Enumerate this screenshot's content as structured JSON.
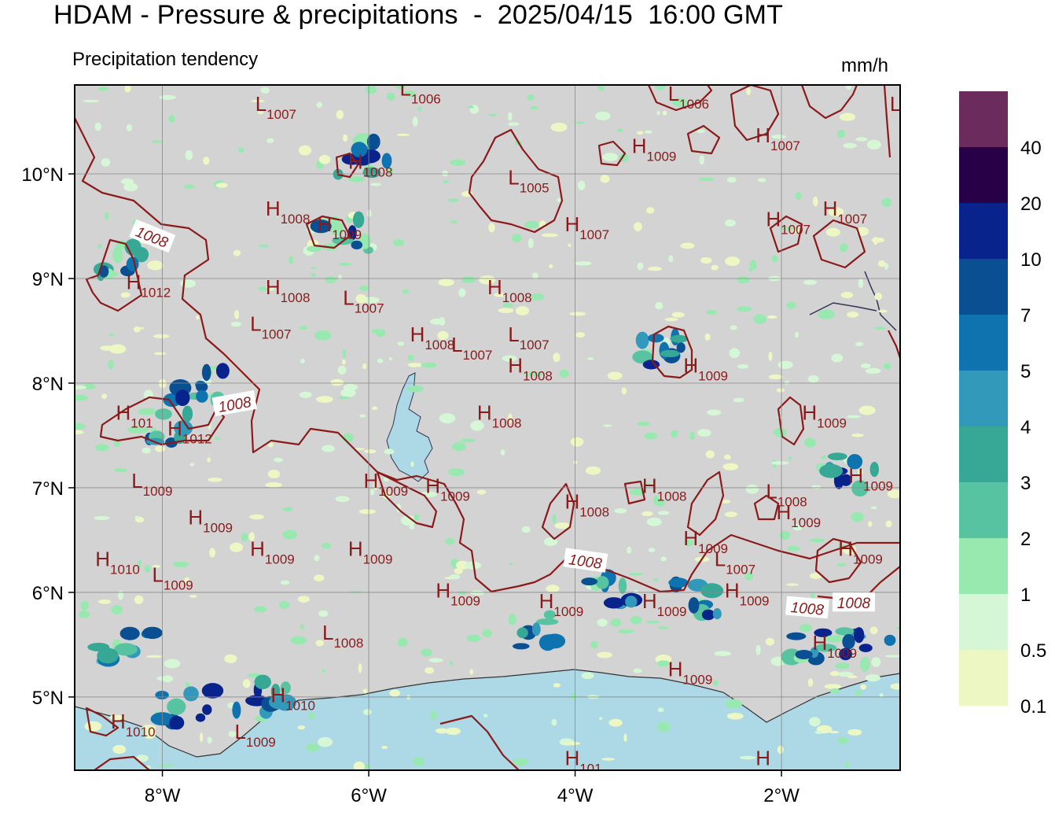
{
  "header": {
    "title": "HDAM - Pressure & precipitations  -  2025/04/15  16:00 GMT",
    "subtitle": "Precipitation tendency",
    "units": "mm/h"
  },
  "map": {
    "lon_range": [
      -8.85,
      -0.85
    ],
    "lat_range": [
      4.3,
      10.85
    ],
    "lat_ticks": [
      "5°N",
      "6°N",
      "7°N",
      "8°N",
      "9°N",
      "10°N"
    ],
    "lon_ticks": [
      "8°W",
      "6°W",
      "4°W",
      "2°W"
    ],
    "colors": {
      "land": "#d3d3d3",
      "sea": "#add8e6",
      "isobar": "#8b1a1a",
      "label": "#8b1a1a",
      "grid": "#888888"
    }
  },
  "pressure_labels": [
    {
      "k": "L",
      "v": "1007",
      "lon": -7.1,
      "lat": 10.6
    },
    {
      "k": "L",
      "v": "1006",
      "lon": -5.7,
      "lat": 10.75
    },
    {
      "k": "L",
      "v": "1006",
      "lon": -3.1,
      "lat": 10.7
    },
    {
      "k": "L",
      "v": "",
      "lon": -0.95,
      "lat": 10.6
    },
    {
      "k": "H",
      "v": "1008",
      "lon": -6.2,
      "lat": 10.05
    },
    {
      "k": "L",
      "v": "1005",
      "lon": -4.65,
      "lat": 9.9
    },
    {
      "k": "H",
      "v": "1009",
      "lon": -3.45,
      "lat": 10.2
    },
    {
      "k": "H",
      "v": "1007",
      "lon": -2.25,
      "lat": 10.3
    },
    {
      "k": "H",
      "v": "1008",
      "lon": -7.0,
      "lat": 9.6
    },
    {
      "k": "H",
      "v": "1009",
      "lon": -6.5,
      "lat": 9.45
    },
    {
      "k": "H",
      "v": "1007",
      "lon": -4.1,
      "lat": 9.45
    },
    {
      "k": "H",
      "v": "1007",
      "lon": -2.15,
      "lat": 9.5
    },
    {
      "k": "H",
      "v": "1007",
      "lon": -1.6,
      "lat": 9.6
    },
    {
      "k": "H",
      "v": "1012",
      "lon": -8.35,
      "lat": 8.9
    },
    {
      "k": "H",
      "v": "1008",
      "lon": -7.0,
      "lat": 8.85
    },
    {
      "k": "L",
      "v": "1007",
      "lon": -6.25,
      "lat": 8.75
    },
    {
      "k": "H",
      "v": "1008",
      "lon": -4.85,
      "lat": 8.85
    },
    {
      "k": "L",
      "v": "1007",
      "lon": -7.15,
      "lat": 8.5
    },
    {
      "k": "H",
      "v": "1008",
      "lon": -5.6,
      "lat": 8.4
    },
    {
      "k": "L",
      "v": "1007",
      "lon": -5.2,
      "lat": 8.3
    },
    {
      "k": "L",
      "v": "1007",
      "lon": -4.65,
      "lat": 8.4
    },
    {
      "k": "H",
      "v": "1008",
      "lon": -4.65,
      "lat": 8.1
    },
    {
      "k": "H",
      "v": "1009",
      "lon": -2.95,
      "lat": 8.1
    },
    {
      "k": "H",
      "v": "1012",
      "lon": -7.95,
      "lat": 7.5
    },
    {
      "k": "H",
      "v": "101",
      "lon": -8.45,
      "lat": 7.65
    },
    {
      "k": "H",
      "v": "1008",
      "lon": -4.95,
      "lat": 7.65
    },
    {
      "k": "H",
      "v": "1009",
      "lon": -1.8,
      "lat": 7.65
    },
    {
      "k": "L",
      "v": "1009",
      "lon": -8.3,
      "lat": 7.0
    },
    {
      "k": "H",
      "v": "1009",
      "lon": -6.05,
      "lat": 7.0
    },
    {
      "k": "H",
      "v": "1009",
      "lon": -5.45,
      "lat": 6.95
    },
    {
      "k": "H",
      "v": "1008",
      "lon": -3.35,
      "lat": 6.95
    },
    {
      "k": "H",
      "v": "1009",
      "lon": -1.35,
      "lat": 7.05
    },
    {
      "k": "H",
      "v": "1008",
      "lon": -4.1,
      "lat": 6.8
    },
    {
      "k": "L",
      "v": "1008",
      "lon": -2.15,
      "lat": 6.9
    },
    {
      "k": "H",
      "v": "1009",
      "lon": -2.05,
      "lat": 6.7
    },
    {
      "k": "H",
      "v": "1009",
      "lon": -7.75,
      "lat": 6.65
    },
    {
      "k": "H",
      "v": "1009",
      "lon": -2.95,
      "lat": 6.45
    },
    {
      "k": "H",
      "v": "1009",
      "lon": -7.15,
      "lat": 6.35
    },
    {
      "k": "H",
      "v": "1009",
      "lon": -6.2,
      "lat": 6.35
    },
    {
      "k": "H",
      "v": "1009",
      "lon": -1.45,
      "lat": 6.35
    },
    {
      "k": "H",
      "v": "1010",
      "lon": -8.65,
      "lat": 6.25
    },
    {
      "k": "L",
      "v": "1009",
      "lon": -8.1,
      "lat": 6.1
    },
    {
      "k": "L",
      "v": "1007",
      "lon": -2.65,
      "lat": 6.25
    },
    {
      "k": "H",
      "v": "1009",
      "lon": -5.35,
      "lat": 5.95
    },
    {
      "k": "H",
      "v": "1009",
      "lon": -2.55,
      "lat": 5.95
    },
    {
      "k": "H",
      "v": "1009",
      "lon": -4.35,
      "lat": 5.85
    },
    {
      "k": "H",
      "v": "1009",
      "lon": -3.35,
      "lat": 5.85
    },
    {
      "k": "L",
      "v": "1008",
      "lon": -6.45,
      "lat": 5.55
    },
    {
      "k": "H",
      "v": "1009",
      "lon": -1.7,
      "lat": 5.45
    },
    {
      "k": "H",
      "v": "1009",
      "lon": -3.1,
      "lat": 5.2
    },
    {
      "k": "H",
      "v": "1010",
      "lon": -6.95,
      "lat": 4.95
    },
    {
      "k": "H",
      "v": "1010",
      "lon": -8.5,
      "lat": 4.7
    },
    {
      "k": "L",
      "v": "1009",
      "lon": -7.3,
      "lat": 4.6
    },
    {
      "k": "H",
      "v": "101",
      "lon": -4.1,
      "lat": 4.35
    },
    {
      "k": "H",
      "v": "",
      "lon": -2.25,
      "lat": 4.35
    }
  ],
  "isobar_labels": [
    {
      "text": "1008",
      "lon": -8.1,
      "lat": 9.4,
      "rot": 22
    },
    {
      "text": "1008",
      "lon": -7.3,
      "lat": 7.8,
      "rot": -10
    },
    {
      "text": "1008",
      "lon": -3.9,
      "lat": 6.3,
      "rot": 8
    },
    {
      "text": "1008",
      "lon": -1.75,
      "lat": 5.85,
      "rot": 5
    },
    {
      "text": "1008",
      "lon": -1.3,
      "lat": 5.9,
      "rot": 0
    }
  ],
  "legend": {
    "levels": [
      "0.1",
      "0.5",
      "1",
      "2",
      "3",
      "4",
      "5",
      "7",
      "10",
      "20",
      "40"
    ],
    "colors": [
      "#ecf7c4",
      "#d6f7d6",
      "#98e9b0",
      "#58c3a0",
      "#36a895",
      "#3399bb",
      "#0f73b0",
      "#094f91",
      "#08238c",
      "#280048",
      "#6b2b5c"
    ]
  }
}
